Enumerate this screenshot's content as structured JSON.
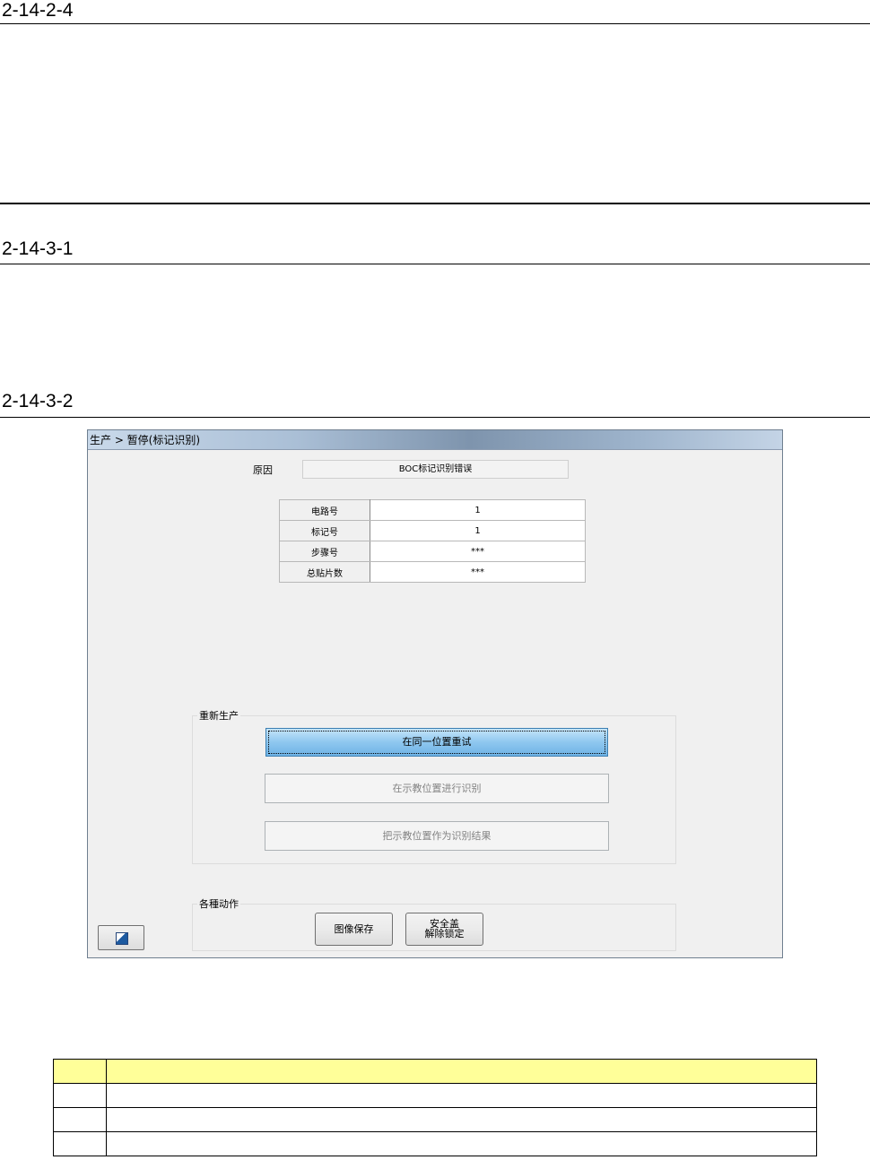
{
  "headings": {
    "h1": "2-14-2-4",
    "h2": "2-14-3-1",
    "h3": "2-14-3-2"
  },
  "window": {
    "title": "生产 > 暂停(标记识别)",
    "reason_label": "原因",
    "reason_value": "BOC标记识别错误",
    "info_rows": [
      {
        "label": "电路号",
        "value": "1"
      },
      {
        "label": "标记号",
        "value": "1"
      },
      {
        "label": "步骤号",
        "value": "***"
      },
      {
        "label": "总贴片数",
        "value": "***"
      }
    ],
    "restart_group": {
      "label": "重新生产",
      "btn_retry": "在同一位置重试",
      "btn_teach_recognize": "在示教位置进行识别",
      "btn_teach_as_result": "把示教位置作为识别结果"
    },
    "actions_group": {
      "label": "各種动作",
      "btn_save_image": "图像保存",
      "btn_safety_release": "安全盖\n解除锁定"
    },
    "corner_icon": "window-icon"
  },
  "bottom_table": {
    "rows": 4
  },
  "colors": {
    "table_header": "#ffff99",
    "primary_button": "#8ec7ef"
  }
}
